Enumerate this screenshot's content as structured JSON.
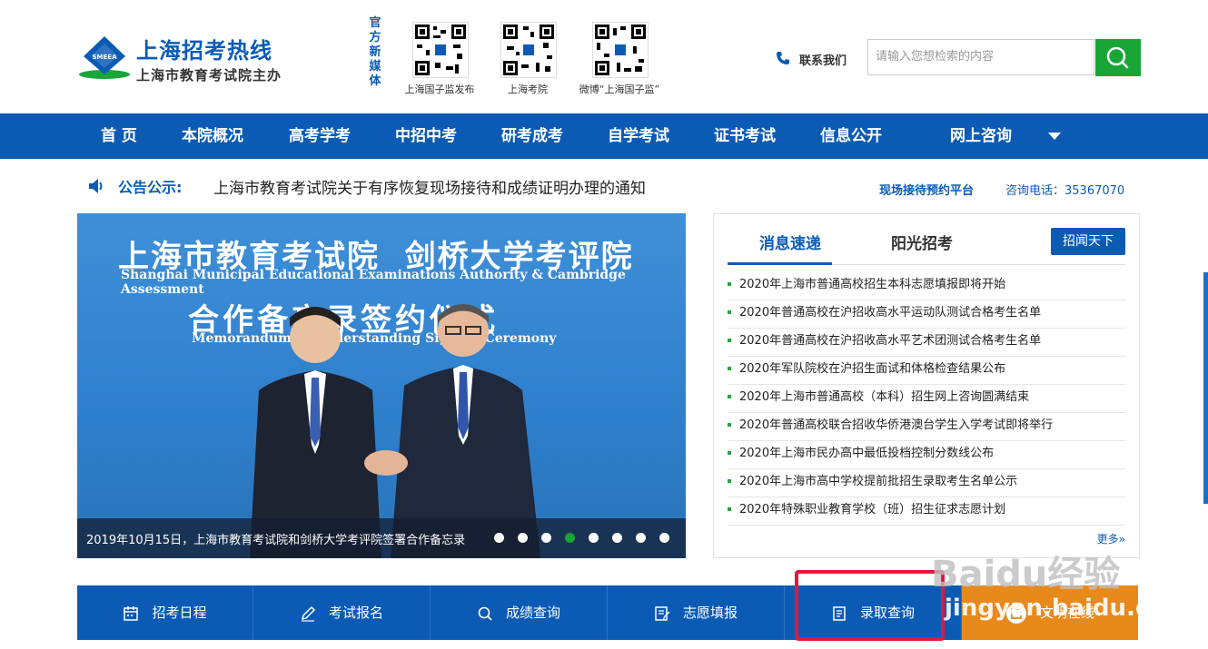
{
  "header": {
    "logo_badge": "SMEEA",
    "site_title": "上海招考热线",
    "site_subtitle": "上海市教育考试院主办",
    "media_label": "官方新媒体",
    "qr_codes": [
      {
        "caption": "上海国子监发布"
      },
      {
        "caption": "上海考院"
      },
      {
        "caption": "微博“上海国子监”"
      }
    ],
    "contact_label": "联系我们",
    "search_placeholder": "请输入您想检索的内容"
  },
  "nav": {
    "items": [
      "首 页",
      "本院概况",
      "高考学考",
      "中招中考",
      "研考成考",
      "自学考试",
      "证书考试",
      "信息公开",
      "网上咨询"
    ]
  },
  "notice": {
    "label": "公告公示:",
    "text": "上海市教育考试院关于有序恢复现场接待和成绩证明办理的通知",
    "platform_link": "现场接待预约平台",
    "phone": "咨询电话：35367070"
  },
  "banner": {
    "headline_cn": "上海市教育考试院  剑桥大学考评院",
    "headline_en": "Shanghai Municipal Educational Examinations Authority & Cambridge Assessment",
    "subline_cn": "合作备忘录签约仪式",
    "subline_en": "Memorandum of Understanding Signing Ceremony",
    "caption": "2019年10月15日，上海市教育考试院和剑桥大学考评院签署合作备忘录",
    "dot_count": 8,
    "active_dot": 3
  },
  "news": {
    "tabs": [
      "消息速递",
      "阳光招考"
    ],
    "button": "招闻天下",
    "items": [
      "2020年上海市普通高校招生本科志愿填报即将开始",
      "2020年普通高校在沪招收高水平运动队测试合格考生名单",
      "2020年普通高校在沪招收高水平艺术团测试合格考生名单",
      "2020年军队院校在沪招生面试和体格检查结果公布",
      "2020年上海市普通高校（本科）招生网上咨询圆满结束",
      "2020年普通高校联合招收华侨港澳台学生入学考试即将举行",
      "2020年上海市民办高中最低投档控制分数线公布",
      "2020年上海市高中学校提前批招生录取考生名单公示",
      "2020年特殊职业教育学校（班）招生征求志愿计划"
    ],
    "more": "更多»"
  },
  "bottom": {
    "items": [
      {
        "label": "招考日程",
        "icon": "calendar-icon"
      },
      {
        "label": "考试报名",
        "icon": "pencil-icon"
      },
      {
        "label": "成绩查询",
        "icon": "magnifier-icon"
      },
      {
        "label": "志愿填报",
        "icon": "form-icon"
      },
      {
        "label": "录取查询",
        "icon": "document-icon"
      },
      {
        "label": "文明在线",
        "icon": "chat-icon"
      }
    ]
  },
  "watermark": {
    "text": "Baidu经验",
    "url": "jingyan.baidu.com"
  },
  "colors": {
    "primary": "#0b5bb5",
    "search_button": "#18a536",
    "orange": "#e8891b",
    "highlight": "#e3173b"
  }
}
